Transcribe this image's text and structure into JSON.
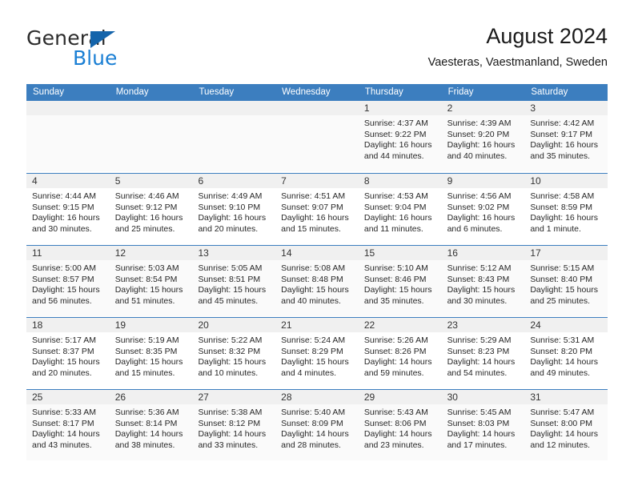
{
  "logo": {
    "word_top": "General",
    "word_bottom": "Blue",
    "triangle_icon": "blue-triangle-icon",
    "color_dark": "#2b2b2b",
    "color_blue": "#1a7fd4"
  },
  "header": {
    "title": "August 2024",
    "subtitle": "Vaesteras, Vaestmanland, Sweden"
  },
  "theme": {
    "header_blue": "#3c7ebf",
    "daynum_gray": "#f0f0f0",
    "row_shade": "#fafafa"
  },
  "weekdays": [
    "Sunday",
    "Monday",
    "Tuesday",
    "Wednesday",
    "Thursday",
    "Friday",
    "Saturday"
  ],
  "weeks": [
    {
      "shaded": true,
      "days": [
        {
          "num": "",
          "empty": true,
          "lines": []
        },
        {
          "num": "",
          "empty": true,
          "lines": []
        },
        {
          "num": "",
          "empty": true,
          "lines": []
        },
        {
          "num": "",
          "empty": true,
          "lines": []
        },
        {
          "num": "1",
          "lines": [
            "Sunrise: 4:37 AM",
            "Sunset: 9:22 PM",
            "Daylight: 16 hours",
            "and 44 minutes."
          ]
        },
        {
          "num": "2",
          "lines": [
            "Sunrise: 4:39 AM",
            "Sunset: 9:20 PM",
            "Daylight: 16 hours",
            "and 40 minutes."
          ]
        },
        {
          "num": "3",
          "lines": [
            "Sunrise: 4:42 AM",
            "Sunset: 9:17 PM",
            "Daylight: 16 hours",
            "and 35 minutes."
          ]
        }
      ]
    },
    {
      "shaded": false,
      "days": [
        {
          "num": "4",
          "lines": [
            "Sunrise: 4:44 AM",
            "Sunset: 9:15 PM",
            "Daylight: 16 hours",
            "and 30 minutes."
          ]
        },
        {
          "num": "5",
          "lines": [
            "Sunrise: 4:46 AM",
            "Sunset: 9:12 PM",
            "Daylight: 16 hours",
            "and 25 minutes."
          ]
        },
        {
          "num": "6",
          "lines": [
            "Sunrise: 4:49 AM",
            "Sunset: 9:10 PM",
            "Daylight: 16 hours",
            "and 20 minutes."
          ]
        },
        {
          "num": "7",
          "lines": [
            "Sunrise: 4:51 AM",
            "Sunset: 9:07 PM",
            "Daylight: 16 hours",
            "and 15 minutes."
          ]
        },
        {
          "num": "8",
          "lines": [
            "Sunrise: 4:53 AM",
            "Sunset: 9:04 PM",
            "Daylight: 16 hours",
            "and 11 minutes."
          ]
        },
        {
          "num": "9",
          "lines": [
            "Sunrise: 4:56 AM",
            "Sunset: 9:02 PM",
            "Daylight: 16 hours",
            "and 6 minutes."
          ]
        },
        {
          "num": "10",
          "lines": [
            "Sunrise: 4:58 AM",
            "Sunset: 8:59 PM",
            "Daylight: 16 hours",
            "and 1 minute."
          ]
        }
      ]
    },
    {
      "shaded": true,
      "days": [
        {
          "num": "11",
          "lines": [
            "Sunrise: 5:00 AM",
            "Sunset: 8:57 PM",
            "Daylight: 15 hours",
            "and 56 minutes."
          ]
        },
        {
          "num": "12",
          "lines": [
            "Sunrise: 5:03 AM",
            "Sunset: 8:54 PM",
            "Daylight: 15 hours",
            "and 51 minutes."
          ]
        },
        {
          "num": "13",
          "lines": [
            "Sunrise: 5:05 AM",
            "Sunset: 8:51 PM",
            "Daylight: 15 hours",
            "and 45 minutes."
          ]
        },
        {
          "num": "14",
          "lines": [
            "Sunrise: 5:08 AM",
            "Sunset: 8:48 PM",
            "Daylight: 15 hours",
            "and 40 minutes."
          ]
        },
        {
          "num": "15",
          "lines": [
            "Sunrise: 5:10 AM",
            "Sunset: 8:46 PM",
            "Daylight: 15 hours",
            "and 35 minutes."
          ]
        },
        {
          "num": "16",
          "lines": [
            "Sunrise: 5:12 AM",
            "Sunset: 8:43 PM",
            "Daylight: 15 hours",
            "and 30 minutes."
          ]
        },
        {
          "num": "17",
          "lines": [
            "Sunrise: 5:15 AM",
            "Sunset: 8:40 PM",
            "Daylight: 15 hours",
            "and 25 minutes."
          ]
        }
      ]
    },
    {
      "shaded": false,
      "days": [
        {
          "num": "18",
          "lines": [
            "Sunrise: 5:17 AM",
            "Sunset: 8:37 PM",
            "Daylight: 15 hours",
            "and 20 minutes."
          ]
        },
        {
          "num": "19",
          "lines": [
            "Sunrise: 5:19 AM",
            "Sunset: 8:35 PM",
            "Daylight: 15 hours",
            "and 15 minutes."
          ]
        },
        {
          "num": "20",
          "lines": [
            "Sunrise: 5:22 AM",
            "Sunset: 8:32 PM",
            "Daylight: 15 hours",
            "and 10 minutes."
          ]
        },
        {
          "num": "21",
          "lines": [
            "Sunrise: 5:24 AM",
            "Sunset: 8:29 PM",
            "Daylight: 15 hours",
            "and 4 minutes."
          ]
        },
        {
          "num": "22",
          "lines": [
            "Sunrise: 5:26 AM",
            "Sunset: 8:26 PM",
            "Daylight: 14 hours",
            "and 59 minutes."
          ]
        },
        {
          "num": "23",
          "lines": [
            "Sunrise: 5:29 AM",
            "Sunset: 8:23 PM",
            "Daylight: 14 hours",
            "and 54 minutes."
          ]
        },
        {
          "num": "24",
          "lines": [
            "Sunrise: 5:31 AM",
            "Sunset: 8:20 PM",
            "Daylight: 14 hours",
            "and 49 minutes."
          ]
        }
      ]
    },
    {
      "shaded": true,
      "days": [
        {
          "num": "25",
          "lines": [
            "Sunrise: 5:33 AM",
            "Sunset: 8:17 PM",
            "Daylight: 14 hours",
            "and 43 minutes."
          ]
        },
        {
          "num": "26",
          "lines": [
            "Sunrise: 5:36 AM",
            "Sunset: 8:14 PM",
            "Daylight: 14 hours",
            "and 38 minutes."
          ]
        },
        {
          "num": "27",
          "lines": [
            "Sunrise: 5:38 AM",
            "Sunset: 8:12 PM",
            "Daylight: 14 hours",
            "and 33 minutes."
          ]
        },
        {
          "num": "28",
          "lines": [
            "Sunrise: 5:40 AM",
            "Sunset: 8:09 PM",
            "Daylight: 14 hours",
            "and 28 minutes."
          ]
        },
        {
          "num": "29",
          "lines": [
            "Sunrise: 5:43 AM",
            "Sunset: 8:06 PM",
            "Daylight: 14 hours",
            "and 23 minutes."
          ]
        },
        {
          "num": "30",
          "lines": [
            "Sunrise: 5:45 AM",
            "Sunset: 8:03 PM",
            "Daylight: 14 hours",
            "and 17 minutes."
          ]
        },
        {
          "num": "31",
          "lines": [
            "Sunrise: 5:47 AM",
            "Sunset: 8:00 PM",
            "Daylight: 14 hours",
            "and 12 minutes."
          ]
        }
      ]
    }
  ]
}
